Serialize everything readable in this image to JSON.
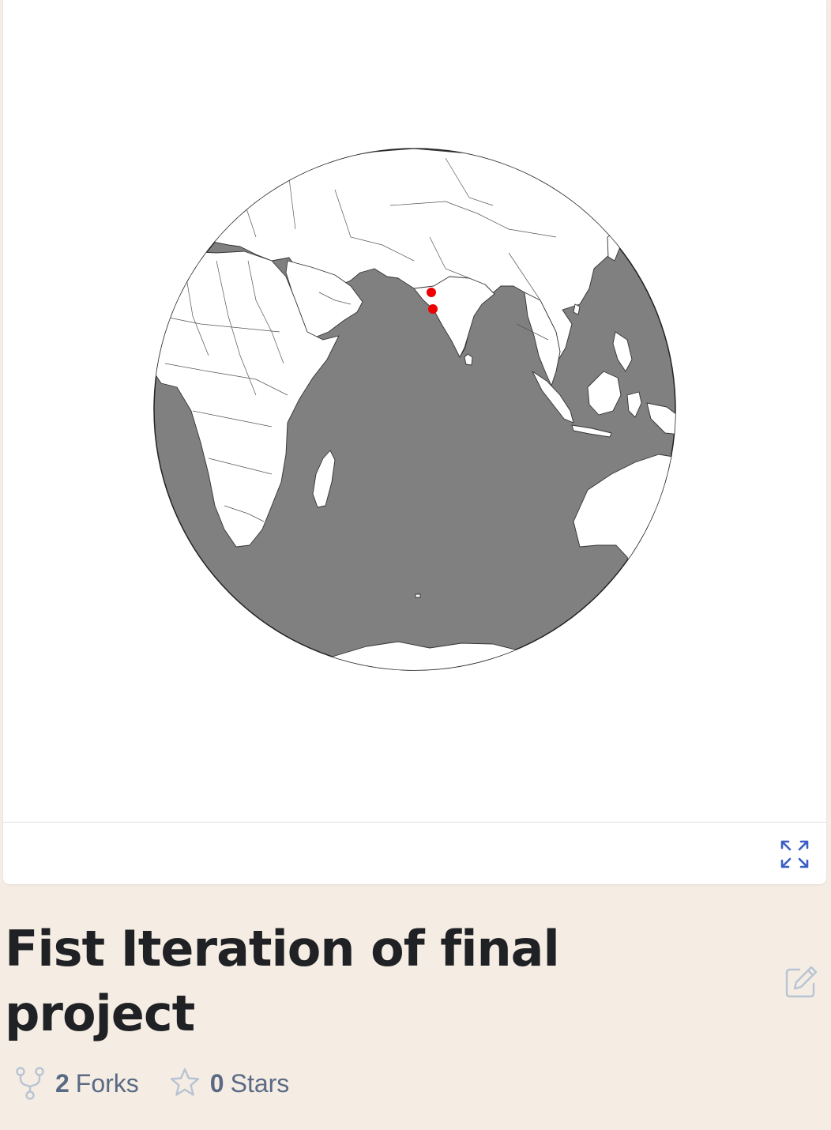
{
  "map": {
    "ocean_color": "#808080",
    "land_color": "#ffffff",
    "marker_color": "#ee0000",
    "markers": [
      {
        "name": "marker-1"
      },
      {
        "name": "marker-2"
      }
    ]
  },
  "toolbar": {
    "fullscreen_icon": "expand-arrows-icon"
  },
  "project": {
    "title": "Fist Iteration of final project",
    "edit_icon": "edit-pencil-icon"
  },
  "stats": {
    "forks_count": "2",
    "forks_label": "Forks",
    "stars_count": "0",
    "stars_label": "Stars"
  }
}
